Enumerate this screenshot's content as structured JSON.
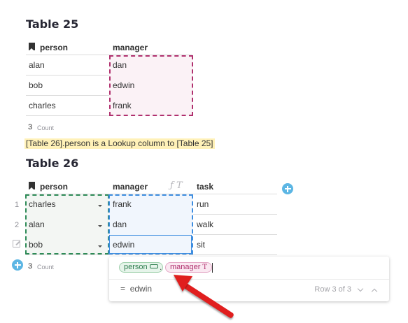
{
  "table25": {
    "title": "Table 25",
    "columns": [
      "person",
      "manager"
    ],
    "rows": [
      {
        "person": "alan",
        "manager": "dan"
      },
      {
        "person": "bob",
        "manager": "edwin"
      },
      {
        "person": "charles",
        "manager": "frank"
      }
    ],
    "count_value": "3",
    "count_label": "Count"
  },
  "note": "[Table 26].person is a Lookup column to [Table 25]",
  "table26": {
    "title": "Table 26",
    "columns": [
      "person",
      "manager",
      "task"
    ],
    "rows": [
      {
        "row": "1",
        "person": "charles",
        "manager": "frank",
        "task": "run"
      },
      {
        "row": "2",
        "person": "alan",
        "manager": "dan",
        "task": "walk"
      },
      {
        "row": "",
        "person": "bob",
        "manager": "edwin",
        "task": "sit"
      }
    ],
    "count_value": "3",
    "count_label": "Count",
    "formula_icons": "ƒ T"
  },
  "formula_editor": {
    "chip_person": "person",
    "dot": ".",
    "chip_manager": "manager",
    "result_prefix": "=",
    "result_value": "edwin",
    "row_info": "Row 3 of 3"
  },
  "colors": {
    "reference_chip": "#2e7d4f",
    "text_chip": "#b0306e",
    "selection_pink": "#b0306e",
    "selection_green": "#2e8b57",
    "selection_blue": "#3d8de0",
    "note_highlight": "#fff1b8",
    "arrow": "#e01e1e"
  }
}
